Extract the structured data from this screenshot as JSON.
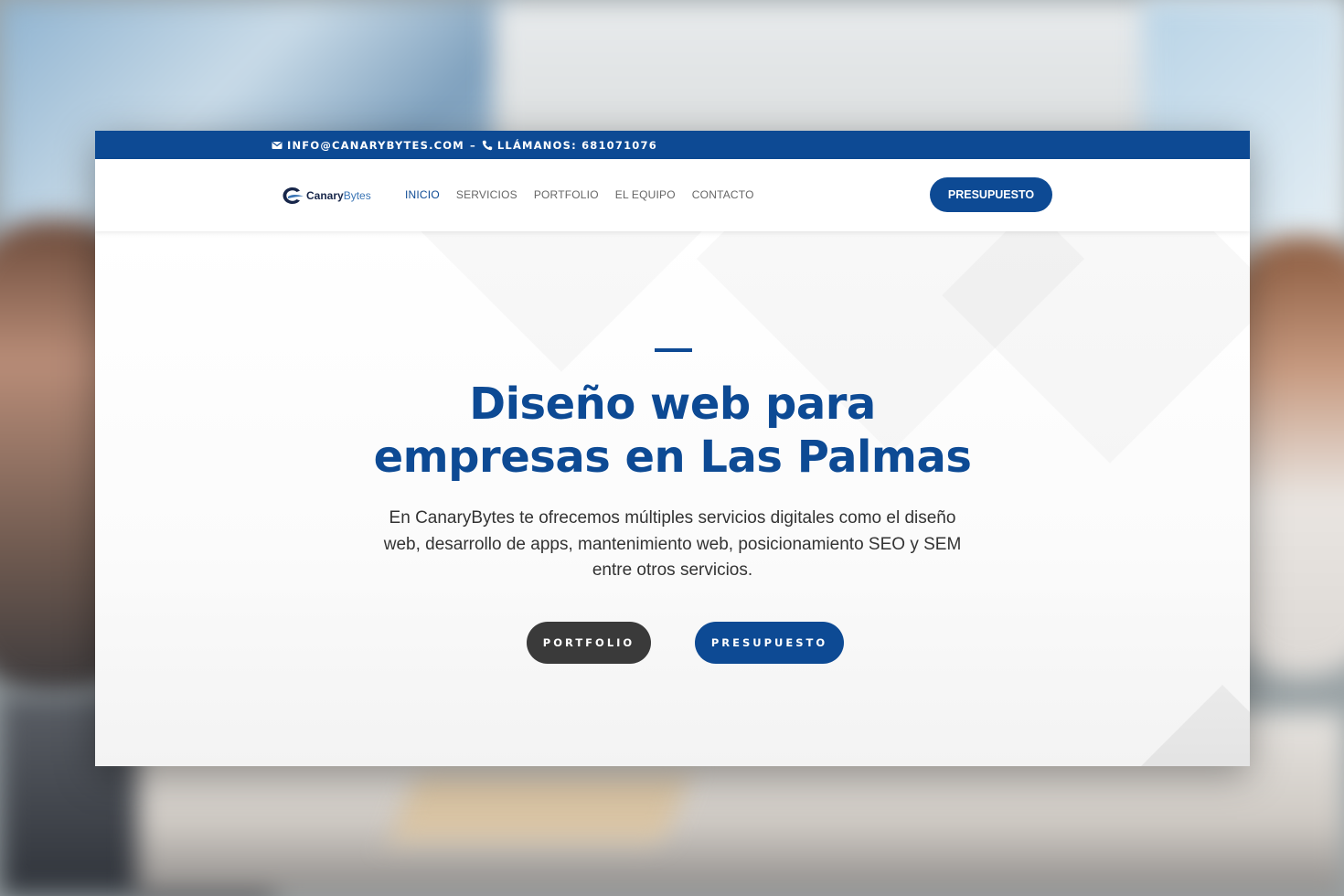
{
  "topbar": {
    "email": "INFO@CANARYBYTES.COM",
    "separator": "–",
    "phone_label": "LLÁMANOS: 681071076"
  },
  "logo": {
    "part1": "Canary",
    "part2": "Bytes"
  },
  "nav": {
    "items": [
      {
        "label": "INICIO",
        "active": true
      },
      {
        "label": "SERVICIOS",
        "active": false
      },
      {
        "label": "PORTFOLIO",
        "active": false
      },
      {
        "label": "EL EQUIPO",
        "active": false
      },
      {
        "label": "CONTACTO",
        "active": false
      }
    ],
    "cta_label": "PRESUPUESTO"
  },
  "hero": {
    "title_line1": "Diseño web para",
    "title_line2": "empresas en Las Palmas",
    "lead": "En CanaryBytes te ofrecemos múltiples servicios digitales como el diseño web, desarrollo de apps, mantenimiento web, posicionamiento SEO y SEM entre otros servicios.",
    "button_portfolio": "PORTFOLIO",
    "button_presupuesto": "PRESUPUESTO"
  },
  "colors": {
    "brand_blue": "#0d4a94",
    "dark_button": "#3a3a3a"
  },
  "icons": [
    "envelope-icon",
    "phone-icon",
    "logo-mark-icon"
  ]
}
